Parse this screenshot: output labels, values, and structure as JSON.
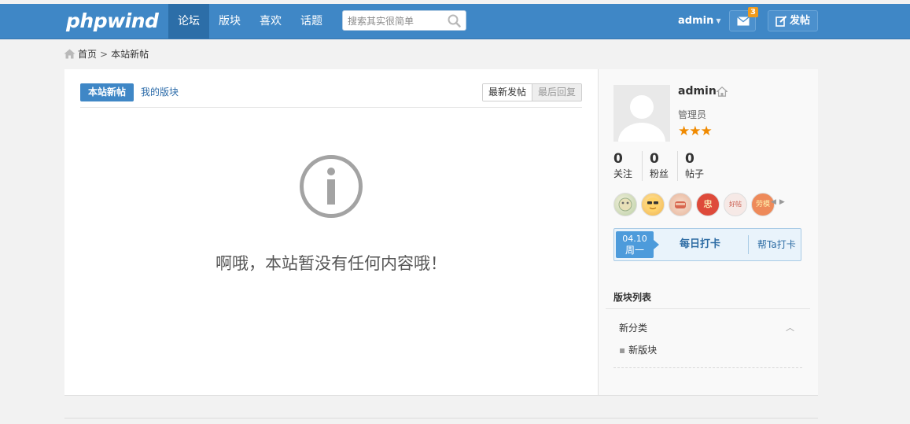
{
  "header": {
    "logo": "phpwind",
    "nav": [
      "论坛",
      "版块",
      "喜欢",
      "话题"
    ],
    "search_placeholder": "搜索其实很简单",
    "username": "admin",
    "message_count": "3",
    "post_label": "发帖"
  },
  "breadcrumb": {
    "home": "首页",
    "sep": ">",
    "current": "本站新帖"
  },
  "main": {
    "tab_active": "本站新帖",
    "tab_other": "我的版块",
    "sort_newest": "最新发帖",
    "sort_reply": "最后回复",
    "empty_message": "啊哦，本站暂没有任何内容哦！"
  },
  "sidebar": {
    "username": "admin",
    "role": "管理员",
    "stars": "★★★",
    "stats": [
      {
        "num": "0",
        "label": "关注"
      },
      {
        "num": "0",
        "label": "粉丝"
      },
      {
        "num": "0",
        "label": "帖子"
      }
    ],
    "medals": [
      "",
      "",
      "",
      "忠",
      "好帖",
      "劳模"
    ],
    "medal_arrows": "◀▶",
    "checkin": {
      "date": "04.10",
      "weekday": "周一",
      "daily": "每日打卡",
      "help": "帮Ta打卡"
    },
    "forums_title": "版块列表",
    "category": "新分类",
    "category_toggle": "︿",
    "forum": "新版块",
    "forum_dot": "▪"
  },
  "colors": {
    "primary": "#3f87c6",
    "star": "#f08a00",
    "badge": "#f09a1c"
  }
}
